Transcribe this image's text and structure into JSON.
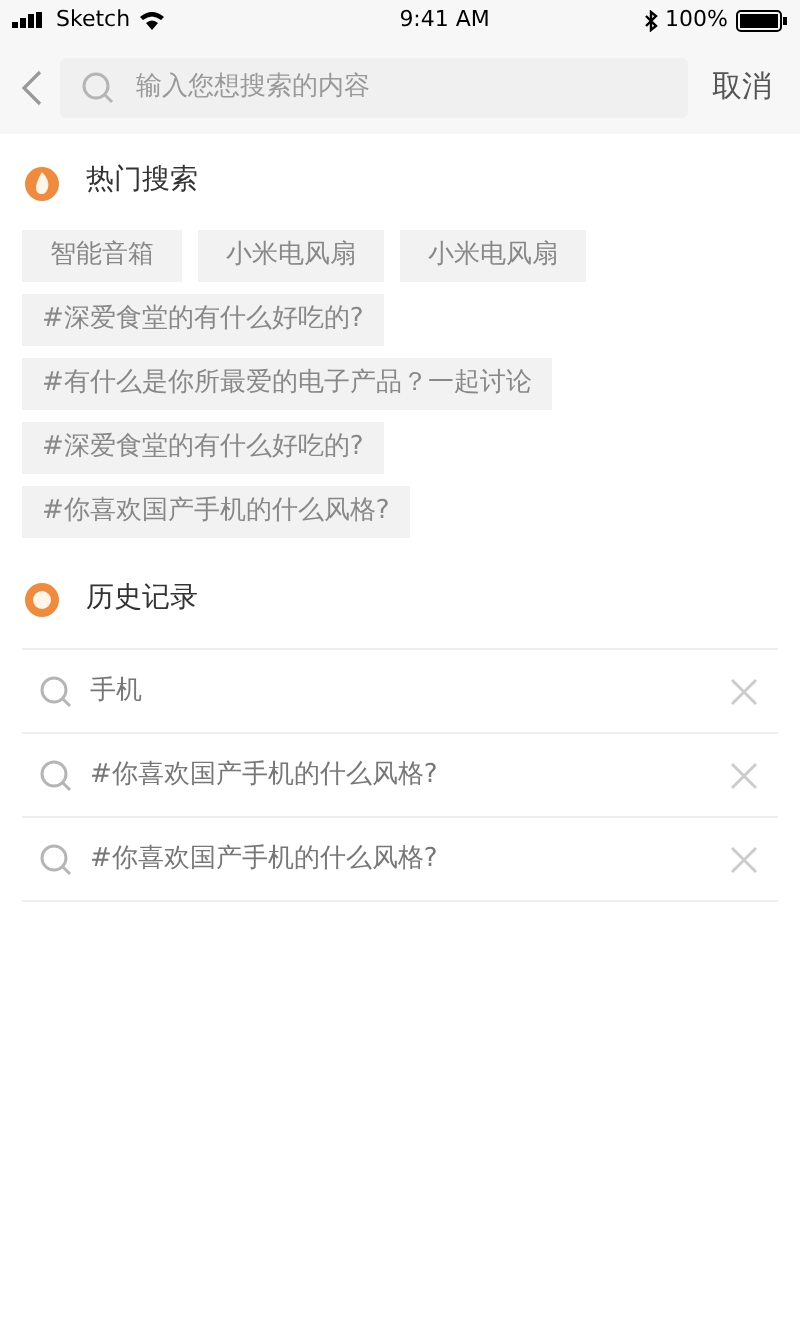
{
  "status_bar": {
    "carrier": "Sketch",
    "time": "9:41 AM",
    "battery": "100%"
  },
  "search": {
    "placeholder": "输入您想搜索的内容",
    "cancel": "取消"
  },
  "hot": {
    "title": "热门搜索",
    "tags": [
      {
        "label": "智能音箱"
      },
      {
        "label": "小米电风扇"
      },
      {
        "label": "小米电风扇"
      },
      {
        "label": "#深爱食堂的有什么好吃的?"
      },
      {
        "label": "#有什么是你所最爱的电子产品？一起讨论"
      },
      {
        "label": "#深爱食堂的有什么好吃的?"
      },
      {
        "label": "#你喜欢国产手机的什么风格?"
      }
    ]
  },
  "history": {
    "title": "历史记录",
    "items": [
      {
        "label": "手机"
      },
      {
        "label": "#你喜欢国产手机的什么风格?"
      },
      {
        "label": "#你喜欢国产手机的什么风格?"
      }
    ]
  }
}
